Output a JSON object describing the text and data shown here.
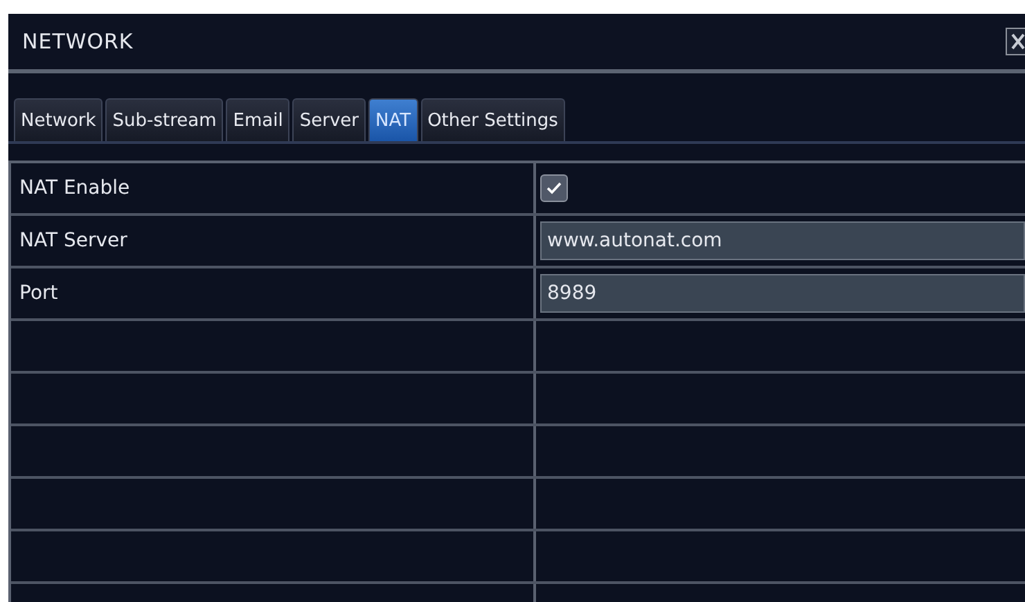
{
  "window": {
    "title": "NETWORK"
  },
  "tabs": [
    {
      "label": "Network",
      "selected": false
    },
    {
      "label": "Sub-stream",
      "selected": false
    },
    {
      "label": "Email",
      "selected": false
    },
    {
      "label": "Server",
      "selected": false
    },
    {
      "label": "NAT",
      "selected": true
    },
    {
      "label": "Other Settings",
      "selected": false
    }
  ],
  "settings": [
    {
      "kind": "checkbox",
      "label": "NAT Enable",
      "checked": true
    },
    {
      "kind": "text",
      "label": "NAT Server",
      "value": "www.autonat.com"
    },
    {
      "kind": "text",
      "label": "Port",
      "value": "8989"
    }
  ]
}
